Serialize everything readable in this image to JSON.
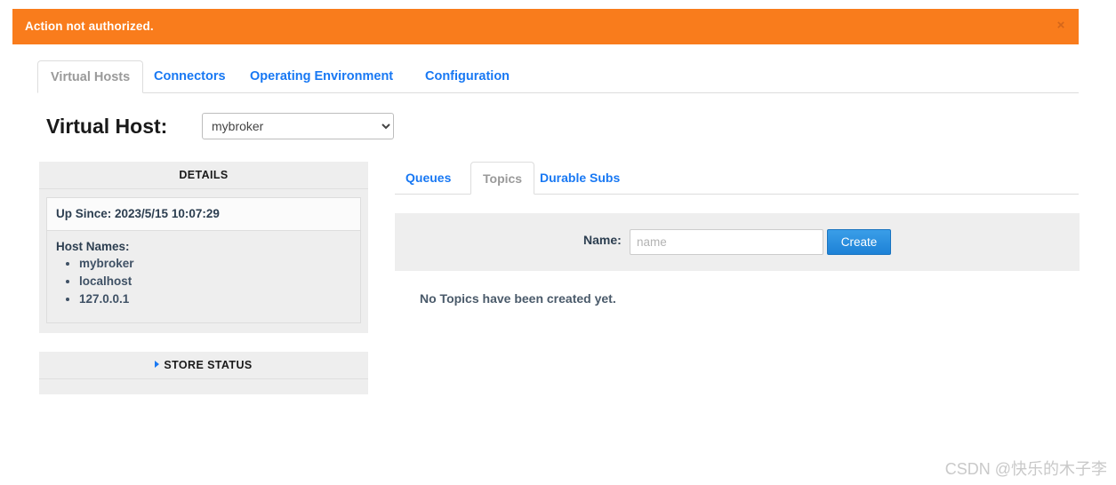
{
  "alert": {
    "message": "Action not authorized.",
    "close_icon": "close-icon",
    "close_label": "×",
    "background": "#f97c1c"
  },
  "primary_tabs": [
    {
      "label": "Virtual Hosts",
      "active": true
    },
    {
      "label": "Connectors",
      "active": false
    },
    {
      "label": "Operating Environment",
      "active": false
    },
    {
      "label": "Configuration",
      "active": false
    }
  ],
  "vhost": {
    "label": "Virtual Host:",
    "selected": "mybroker",
    "options": [
      "mybroker"
    ]
  },
  "details": {
    "heading": "DETAILS",
    "up_since_label": "Up Since:",
    "up_since_value": "2023/5/15 10:07:29",
    "up_since_full": "Up Since: 2023/5/15 10:07:29",
    "host_names_label": "Host Names:",
    "host_names": [
      "mybroker",
      "localhost",
      "127.0.0.1"
    ]
  },
  "store_status": {
    "heading": "STORE STATUS",
    "caret_icon": "caret-right-icon",
    "expanded": false
  },
  "sub_tabs": [
    {
      "label": "Queues",
      "active": false
    },
    {
      "label": "Topics",
      "active": true
    },
    {
      "label": "Durable Subs",
      "active": false
    }
  ],
  "create_form": {
    "name_label": "Name:",
    "name_value": "",
    "name_placeholder": "name",
    "submit_label": "Create",
    "submit_color": "#2f96e0"
  },
  "empty_state": {
    "message": "No Topics have been created yet."
  },
  "watermark": {
    "text": "CSDN @快乐的木子李"
  }
}
